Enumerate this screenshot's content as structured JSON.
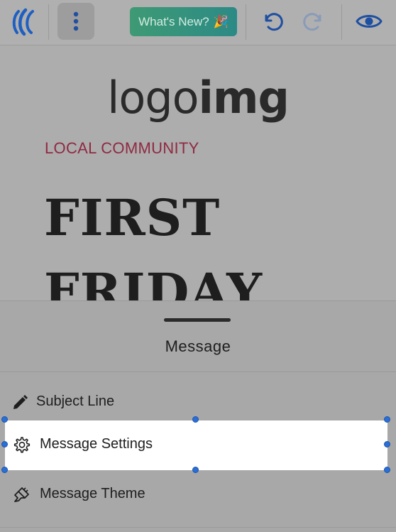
{
  "toolbar": {
    "logo_icon": "brand-logo-icon",
    "more_icon": "more-vertical-icon",
    "whats_new_label": "What's New?",
    "whats_new_emoji": "🎉",
    "undo_icon": "undo-icon",
    "redo_icon": "redo-icon",
    "preview_icon": "eye-icon",
    "accent_color": "#1f5fc0"
  },
  "preview": {
    "logo_light": "logo",
    "logo_bold": "img",
    "eyebrow": "LOCAL COMMUNITY",
    "headline_line1": "FIRST",
    "headline_line2": "FRIDAY"
  },
  "sheet": {
    "title": "Message",
    "items": [
      {
        "label": "Subject Line",
        "icon": "pencil-icon"
      },
      {
        "label": "Message Settings",
        "icon": "gear-icon",
        "selected": true
      },
      {
        "label": "Message Theme",
        "icon": "paintbrush-icon"
      }
    ]
  }
}
